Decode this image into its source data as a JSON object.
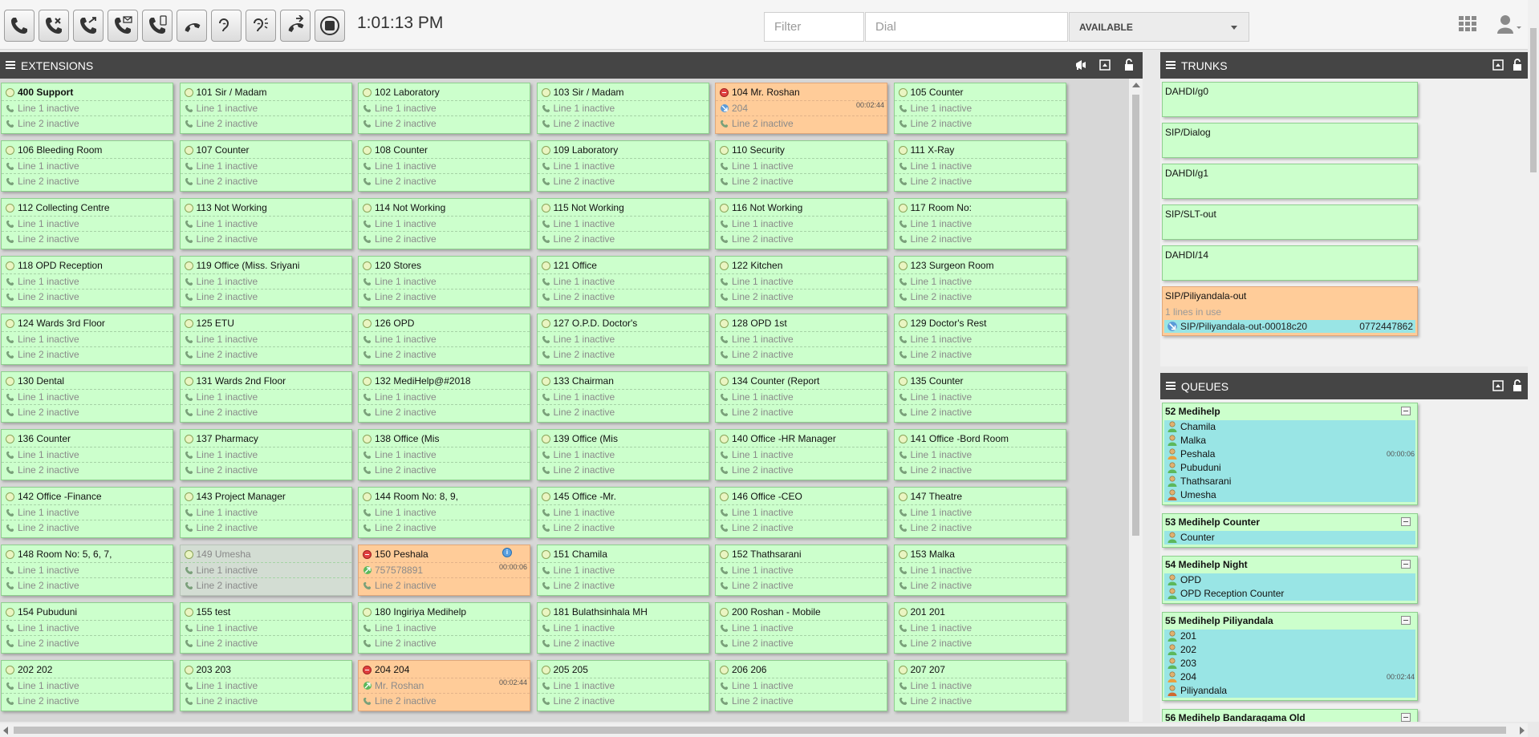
{
  "toolbar": {
    "buttons": [
      {
        "name": "dial-button",
        "icon": "phone-icon"
      },
      {
        "name": "hangup-button",
        "icon": "phone-hangup-icon"
      },
      {
        "name": "transfer-button",
        "icon": "phone-transfer-icon"
      },
      {
        "name": "voicemail-button",
        "icon": "phone-mail-icon"
      },
      {
        "name": "mobile-transfer-button",
        "icon": "phone-mobile-icon"
      },
      {
        "name": "pickup-button",
        "icon": "phone-pickup-icon"
      },
      {
        "name": "listen-button",
        "icon": "ear-icon"
      },
      {
        "name": "whisper-button",
        "icon": "ear-speak-icon"
      },
      {
        "name": "park-button",
        "icon": "phone-park-icon"
      },
      {
        "name": "record-button",
        "icon": "record-icon"
      }
    ],
    "clock": "1:01:13 PM",
    "filter_placeholder": "Filter",
    "dial_placeholder": "Dial",
    "status": "AVAILABLE"
  },
  "extensions_panel": {
    "title": "EXTENSIONS"
  },
  "extensions": [
    {
      "label": "400 Support",
      "bold": true
    },
    {
      "label": "101 Sir / Madam"
    },
    {
      "label": "102 Laboratory"
    },
    {
      "label": "103 Sir / Madam"
    },
    {
      "label": "104 Mr. Roshan",
      "state": "busy",
      "line1": "204",
      "line1_icon": "incoming",
      "timer": "00:02:44"
    },
    {
      "label": "105 Counter"
    },
    {
      "label": "106 Bleeding Room"
    },
    {
      "label": "107 Counter"
    },
    {
      "label": "108 Counter"
    },
    {
      "label": "109 Laboratory"
    },
    {
      "label": "110 Security"
    },
    {
      "label": "111 X-Ray"
    },
    {
      "label": "112 Collecting Centre"
    },
    {
      "label": "113 Not Working"
    },
    {
      "label": "114 Not Working"
    },
    {
      "label": "115 Not Working"
    },
    {
      "label": "116 Not Working"
    },
    {
      "label": "117 Room No:"
    },
    {
      "label": "118 OPD Reception"
    },
    {
      "label": "119 Office (Miss. Sriyani"
    },
    {
      "label": "120 Stores"
    },
    {
      "label": "121 Office"
    },
    {
      "label": "122 Kitchen"
    },
    {
      "label": "123 Surgeon Room"
    },
    {
      "label": "124 Wards 3rd Floor"
    },
    {
      "label": "125 ETU"
    },
    {
      "label": "126 OPD"
    },
    {
      "label": "127 O.P.D. Doctor's"
    },
    {
      "label": "128 OPD 1st"
    },
    {
      "label": "129 Doctor's Rest"
    },
    {
      "label": "130 Dental"
    },
    {
      "label": "131 Wards 2nd Floor"
    },
    {
      "label": "132 MediHelp@#2018"
    },
    {
      "label": "133 Chairman"
    },
    {
      "label": "134 Counter (Report"
    },
    {
      "label": "135 Counter"
    },
    {
      "label": "136 Counter"
    },
    {
      "label": "137 Pharmacy"
    },
    {
      "label": "138 Office (Mis"
    },
    {
      "label": "139 Office (Mis"
    },
    {
      "label": "140 Office -HR Manager"
    },
    {
      "label": "141 Office -Bord Room"
    },
    {
      "label": "142 Office -Finance"
    },
    {
      "label": "143 Project Manager"
    },
    {
      "label": "144 Room No: 8, 9,"
    },
    {
      "label": "145 Office -Mr."
    },
    {
      "label": "146 Office -CEO"
    },
    {
      "label": "147 Theatre"
    },
    {
      "label": "148 Room No: 5, 6, 7,"
    },
    {
      "label": "149 Umesha",
      "state": "offline"
    },
    {
      "label": "150 Peshala",
      "state": "busy",
      "line1": "757578891",
      "line1_icon": "outgoing",
      "timer": "00:00:06",
      "info": true
    },
    {
      "label": "151 Chamila"
    },
    {
      "label": "152 Thathsarani"
    },
    {
      "label": "153 Malka"
    },
    {
      "label": "154 Pubuduni"
    },
    {
      "label": "155 test"
    },
    {
      "label": "180 Ingiriya Medihelp"
    },
    {
      "label": "181 Bulathsinhala MH"
    },
    {
      "label": "200 Roshan - Mobile"
    },
    {
      "label": "201 201"
    },
    {
      "label": "202 202"
    },
    {
      "label": "203 203"
    },
    {
      "label": "204 204",
      "state": "busy",
      "line1": "Mr. Roshan",
      "line1_icon": "outgoing",
      "timer": "00:02:44"
    },
    {
      "label": "205 205"
    },
    {
      "label": "206 206"
    },
    {
      "label": "207 207"
    }
  ],
  "line_labels": {
    "line1": "Line 1 inactive",
    "line2": "Line 2 inactive"
  },
  "trunks_panel": {
    "title": "TRUNKS"
  },
  "trunks": [
    {
      "name": "DAHDI/g0"
    },
    {
      "name": "SIP/Dialog"
    },
    {
      "name": "DAHDI/g1"
    },
    {
      "name": "SIP/SLT-out"
    },
    {
      "name": "DAHDI/14"
    },
    {
      "name": "SIP/Piliyandala-out",
      "busy": true,
      "sub": "1 lines in use",
      "channel": "SIP/Piliyandala-out-00018c20",
      "number": "0772447862"
    }
  ],
  "queues_panel": {
    "title": "QUEUES"
  },
  "queues": [
    {
      "name": "52 Medihelp",
      "timer": "00:00:06",
      "timer_row": 2,
      "members": [
        {
          "name": "Chamila",
          "icon": "agent-icon"
        },
        {
          "name": "Malka",
          "icon": "agent-icon"
        },
        {
          "name": "Peshala",
          "icon": "agent-busy-icon"
        },
        {
          "name": "Pubuduni",
          "icon": "agent-icon"
        },
        {
          "name": "Thathsarani",
          "icon": "agent-icon"
        },
        {
          "name": "Umesha",
          "icon": "agent-offline-icon"
        }
      ]
    },
    {
      "name": "53 Medihelp Counter",
      "members": [
        {
          "name": "Counter",
          "icon": "agent-icon"
        }
      ]
    },
    {
      "name": "54 Medihelp Night",
      "members": [
        {
          "name": "OPD",
          "icon": "agent-icon"
        },
        {
          "name": "OPD Reception Counter",
          "icon": "agent-icon"
        }
      ]
    },
    {
      "name": "55 Medihelp Piliyandala",
      "timer": "00:02:44",
      "timer_row": 3,
      "members": [
        {
          "name": "201",
          "icon": "agent-icon"
        },
        {
          "name": "202",
          "icon": "agent-icon"
        },
        {
          "name": "203",
          "icon": "agent-icon"
        },
        {
          "name": "204",
          "icon": "agent-busy-icon"
        },
        {
          "name": "Piliyandala",
          "icon": "agent-offline-icon"
        }
      ]
    },
    {
      "name": "56 Medihelp Bandaragama Old",
      "members": []
    }
  ],
  "colors": {
    "idle": "#ccffcc",
    "busy": "#ffcc99",
    "offline": "#d3ddd3",
    "member": "#99e5e5",
    "header": "#454545"
  }
}
